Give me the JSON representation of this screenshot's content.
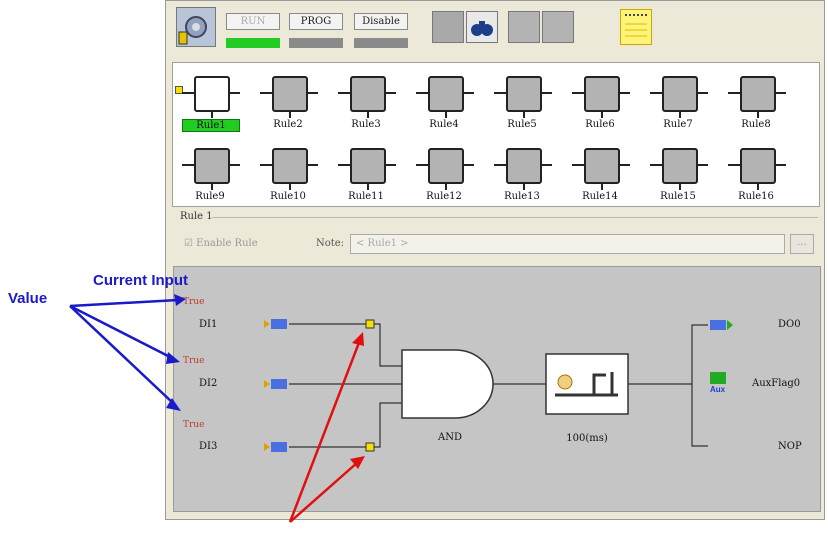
{
  "toolbar": {
    "run_label": "RUN",
    "prog_label": "PROG",
    "disable_label": "Disable",
    "colors": {
      "run": "#22cc22",
      "prog": "#888888",
      "disable": "#888888"
    }
  },
  "rules": [
    "Rule1",
    "Rule2",
    "Rule3",
    "Rule4",
    "Rule5",
    "Rule6",
    "Rule7",
    "Rule8",
    "Rule9",
    "Rule10",
    "Rule11",
    "Rule12",
    "Rule13",
    "Rule14",
    "Rule15",
    "Rule16"
  ],
  "rule_section": {
    "title": "Rule 1",
    "enable_label": "Enable Rule",
    "note_label": "Note:",
    "note_value": "< Rule1 >",
    "browse_label": "..."
  },
  "diagram": {
    "inputs": [
      {
        "name": "DI1",
        "state": "True"
      },
      {
        "name": "DI2",
        "state": "True"
      },
      {
        "name": "DI3",
        "state": "True"
      }
    ],
    "gate": "AND",
    "timer": "100(ms)",
    "outputs": [
      "DO0",
      "AuxFlag0",
      "NOP"
    ],
    "aux_icon_text": "Aux"
  },
  "annotations": {
    "current_input_line1": "Current Input",
    "current_input_line2": "Value"
  }
}
